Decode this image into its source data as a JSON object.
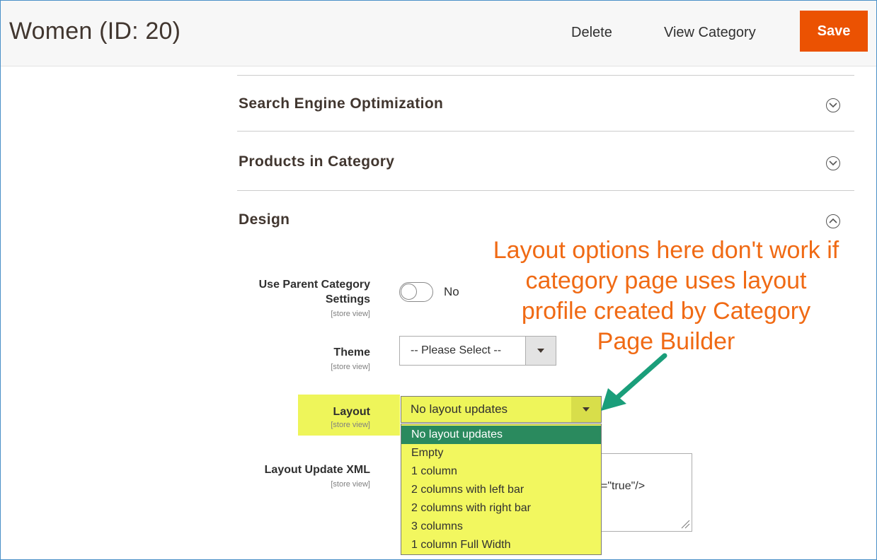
{
  "header": {
    "title": "Women (ID: 20)",
    "delete_label": "Delete",
    "view_label": "View Category",
    "save_label": "Save"
  },
  "sections": [
    {
      "title": "Search Engine Optimization",
      "expanded": false
    },
    {
      "title": "Products in Category",
      "expanded": false
    },
    {
      "title": "Design",
      "expanded": true
    }
  ],
  "design": {
    "parent_settings": {
      "label_line1": "Use Parent Category",
      "label_line2": "Settings",
      "scope": "[store view]",
      "toggle_text": "No",
      "value": false
    },
    "theme": {
      "label": "Theme",
      "scope": "[store view]",
      "value": "-- Please Select --"
    },
    "layout": {
      "label": "Layout",
      "scope": "[store view]",
      "value": "No layout updates",
      "options": [
        "No layout updates",
        "Empty",
        "1 column",
        "2 columns with left bar",
        "2 columns with right bar",
        "3 columns",
        "1 column Full Width"
      ]
    },
    "layout_xml": {
      "label": "Layout Update XML",
      "scope": "[store view]",
      "visible_text": "=\"true\"/>"
    }
  },
  "annotation": {
    "lines": [
      "Layout options here don't work if",
      "category page uses layout",
      "profile created by Category",
      "Page Builder"
    ]
  },
  "colors": {
    "accent": "#eb5202",
    "annotation": "#f06a14",
    "highlight": "#eef55a",
    "selected_option": "#2a8a5e",
    "arrow": "#1a9e7a"
  }
}
